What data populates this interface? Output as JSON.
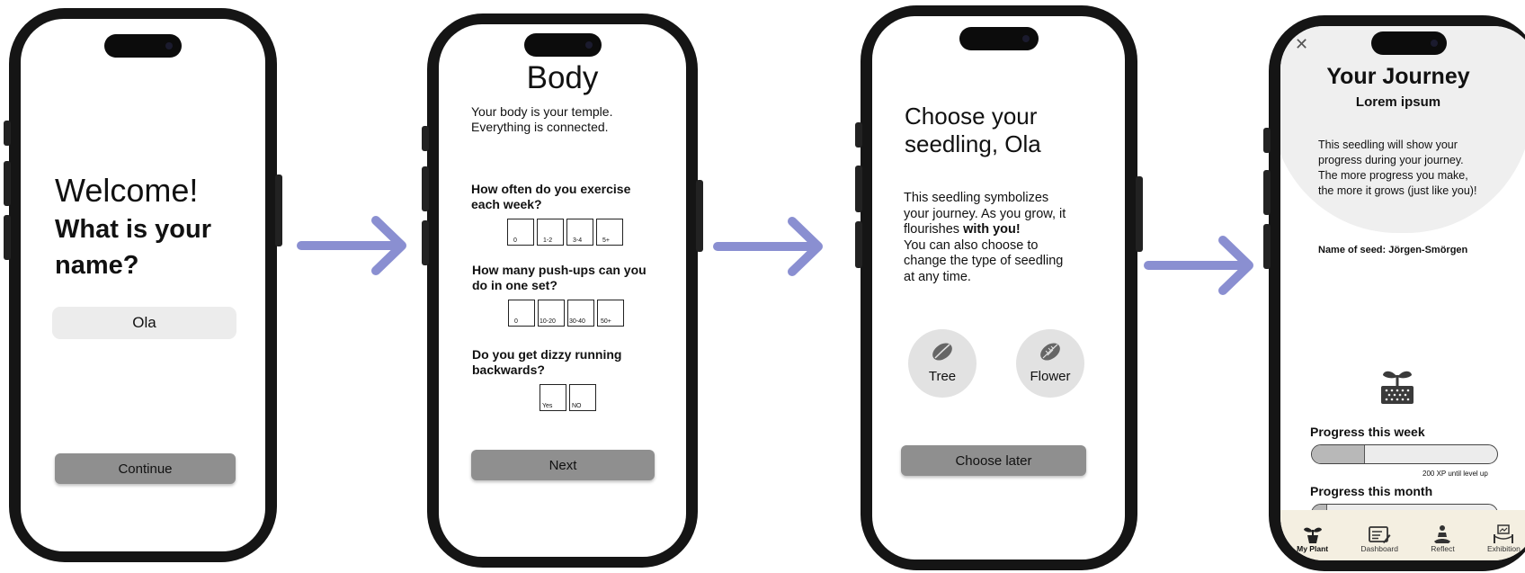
{
  "colors": {
    "arrow": "#8a8fd1",
    "button_grey": "#8f8f8f",
    "nav_bg": "#f4efe1",
    "input_bg": "#ececec"
  },
  "screen1": {
    "welcome": "Welcome!",
    "question_line1": "What is your",
    "question_line2": "name?",
    "name_value": "Ola",
    "continue_label": "Continue"
  },
  "screen2": {
    "title": "Body",
    "intro_line1": "Your body is your temple.",
    "intro_line2": "Everything is connected.",
    "questions": [
      {
        "line1": "How often do you exercise",
        "line2": "each week?",
        "options": [
          "0",
          "1-2",
          "3-4",
          "5+"
        ]
      },
      {
        "line1": "How many push-ups can you",
        "line2": "do in one set?",
        "options": [
          "0",
          "10-20",
          "30-40",
          "50+"
        ]
      },
      {
        "line1": "Do you get dizzy running",
        "line2": "backwards?",
        "options": [
          "Yes",
          "NO"
        ]
      }
    ],
    "next_label": "Next"
  },
  "screen3": {
    "title_line1": "Choose your",
    "title_line2": "seedling, Ola",
    "text_line1": "This seedling symbolizes",
    "text_line2": "your journey. As you grow, it",
    "text_line3a": "flourishes ",
    "text_line3b": "with you!",
    "text_line4": "You can also choose to",
    "text_line5": "change the type of seedling",
    "text_line6": "at any time.",
    "seed_options": [
      "Tree",
      "Flower"
    ],
    "choose_later_label": "Choose later"
  },
  "screen4": {
    "close_symbol": "✕",
    "title": "Your Journey",
    "subtitle": "Lorem ipsum",
    "text_line1": "This seedling will show your",
    "text_line2": "progress during your journey.",
    "text_line3": "The more progress you make,",
    "text_line4": "the more it grows (just like you)!",
    "seed_name": "Name of seed: Jörgen-Smörgen",
    "progress_week_label": "Progress this week",
    "progress_week_fraction": 0.28,
    "xp_note": "200 XP until level up",
    "progress_month_label": "Progress this month",
    "progress_month_fraction": 0.08,
    "nav": [
      {
        "label": "My Plant",
        "icon": "plant-icon",
        "active": true
      },
      {
        "label": "Dashboard",
        "icon": "dashboard-icon",
        "active": false
      },
      {
        "label": "Reflect",
        "icon": "meditation-icon",
        "active": false
      },
      {
        "label": "Exhibition",
        "icon": "exhibition-icon",
        "active": false
      }
    ]
  }
}
